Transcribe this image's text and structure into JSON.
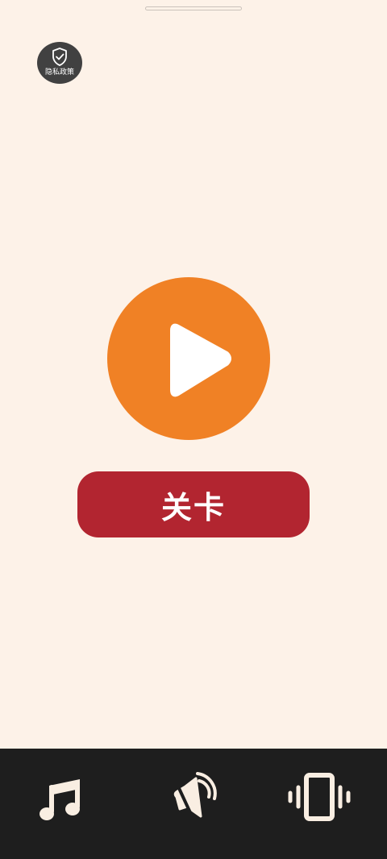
{
  "privacy": {
    "label": "隐私政策",
    "icon": "shield-check-icon"
  },
  "play": {
    "icon": "play-icon"
  },
  "level_button": {
    "label": "关卡"
  },
  "bottom_bar": {
    "items": [
      {
        "icon": "music-note-icon"
      },
      {
        "icon": "sound-off-icon"
      },
      {
        "icon": "vibrate-icon"
      }
    ]
  },
  "colors": {
    "background": "#fdf2e8",
    "play_button": "#f08125",
    "level_button": "#b22530",
    "bottom_bar": "#1e1e1e",
    "bar_icons": "#f9eee2",
    "privacy_button": "#414141"
  }
}
